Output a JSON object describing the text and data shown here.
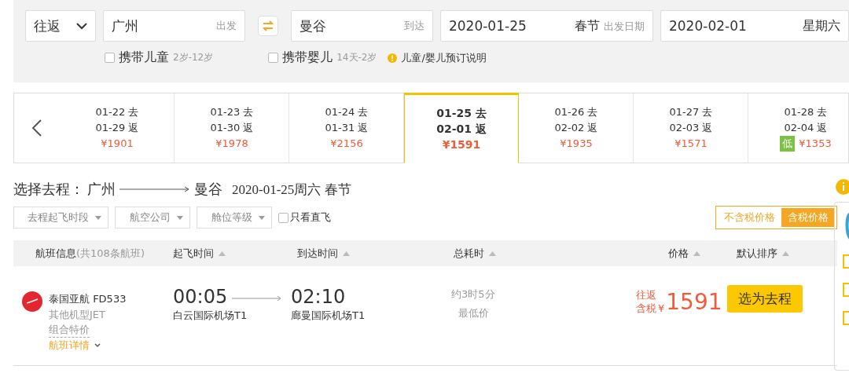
{
  "search": {
    "trip_type": "往返",
    "origin": {
      "value": "广州",
      "label": "出发"
    },
    "destination": {
      "value": "曼谷",
      "label": "到达"
    },
    "depart_date": {
      "value": "2020-01-25",
      "holiday": "春节",
      "label": "出发日期"
    },
    "return_date": {
      "value": "2020-02-01",
      "weekday": "星期六"
    },
    "options": [
      {
        "label": "携带儿童",
        "hint": "2岁-12岁",
        "checked": false
      },
      {
        "label": "携带婴儿",
        "hint": "14天-2岁",
        "checked": false
      }
    ],
    "note": "儿童/婴儿预订说明"
  },
  "date_strip": [
    {
      "out": "01-22 去",
      "back": "01-29 返",
      "price": "¥1901",
      "selected": false
    },
    {
      "out": "01-23 去",
      "back": "01-30 返",
      "price": "¥1978",
      "selected": false
    },
    {
      "out": "01-24 去",
      "back": "01-31 返",
      "price": "¥2156",
      "selected": false
    },
    {
      "out": "01-25 去",
      "back": "02-01 返",
      "price": "¥1591",
      "selected": true
    },
    {
      "out": "01-26 去",
      "back": "02-02 返",
      "price": "¥1935",
      "selected": false
    },
    {
      "out": "01-27 去",
      "back": "02-03 返",
      "price": "¥1571",
      "selected": false
    },
    {
      "out": "01-28 去",
      "back": "02-04 返",
      "price": "¥1353",
      "badge": "低",
      "selected": false
    }
  ],
  "heading": {
    "label": "选择去程：",
    "from": "广州",
    "to": "曼谷",
    "date": "2020-01-25周六 春节"
  },
  "filters": [
    {
      "label": "去程起飞时段",
      "kind": "dropdown"
    },
    {
      "label": "航空公司",
      "kind": "dropdown"
    },
    {
      "label": "舱位等级",
      "kind": "dropdown"
    },
    {
      "label": "只看直飞",
      "kind": "checkbox",
      "checked": false
    }
  ],
  "price_toggle": [
    {
      "label": "不含税价格",
      "selected": false
    },
    {
      "label": "含税价格",
      "selected": true
    }
  ],
  "columns": [
    {
      "label": "航班信息",
      "count": "(共108条航班)"
    },
    {
      "label": "起飞时间"
    },
    {
      "label": "到达时间"
    },
    {
      "label": "总耗时"
    },
    {
      "label": "价格"
    },
    {
      "label": "默认排序"
    }
  ],
  "flights": [
    {
      "airline": "泰国亚航 FD533",
      "aircraft": "其他机型JET",
      "fare_type": "组合特价",
      "details": "航班详情",
      "dep_time": "00:05",
      "dep_airport": "白云国际机场T1",
      "arr_time": "02:10",
      "arr_airport": "廊曼国际机场T1",
      "duration": "约3时5分",
      "tag": "最低价",
      "price_label_1": "往返",
      "price_label_2": "含税",
      "currency": "¥",
      "price": "1591",
      "action": "选为去程"
    }
  ]
}
